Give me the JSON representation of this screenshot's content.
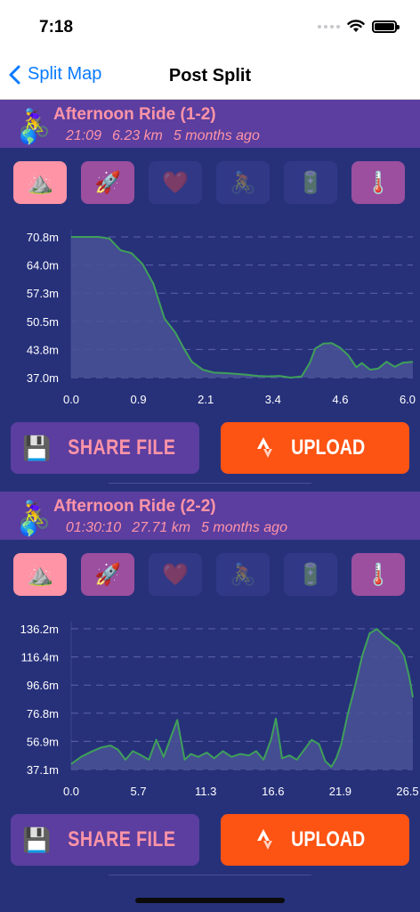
{
  "status": {
    "time": "7:18"
  },
  "nav": {
    "back_label": "Split Map",
    "title": "Post Split"
  },
  "rides": [
    {
      "title": "Afternoon Ride (1-2)",
      "rider_emoji": "🚴‍♀️",
      "globe_emoji": "🌎",
      "duration": "21:09",
      "distance": "6.23 km",
      "ago": "5 months ago",
      "metrics": [
        {
          "name": "elevation",
          "emoji": "⛰️",
          "state": "active-pink"
        },
        {
          "name": "speed",
          "emoji": "🚀",
          "state": "active-purple"
        },
        {
          "name": "heart-rate",
          "emoji": "❤️",
          "state": "inactive"
        },
        {
          "name": "cadence",
          "emoji": "🚴",
          "state": "inactive"
        },
        {
          "name": "power",
          "emoji": "🔋",
          "state": "inactive"
        },
        {
          "name": "temperature",
          "emoji": "🌡️",
          "state": "active-purple"
        }
      ],
      "share_label": "SHARE FILE",
      "upload_label": "UPLOAD",
      "chart_data": {
        "type": "area",
        "ylabel": "",
        "xlabel": "",
        "yticks": [
          "70.8m",
          "64.0m",
          "57.3m",
          "50.5m",
          "43.8m",
          "37.0m"
        ],
        "xticks": [
          "0.0",
          "0.9",
          "2.1",
          "3.4",
          "4.6",
          "6.0"
        ],
        "ylim": [
          37.0,
          70.8
        ],
        "xlim": [
          0.0,
          6.23
        ],
        "x": [
          0.0,
          0.3,
          0.5,
          0.7,
          0.9,
          1.1,
          1.3,
          1.5,
          1.7,
          1.9,
          2.05,
          2.2,
          2.4,
          2.6,
          2.8,
          3.0,
          3.2,
          3.4,
          3.6,
          3.8,
          4.0,
          4.2,
          4.35,
          4.45,
          4.6,
          4.75,
          4.9,
          5.05,
          5.2,
          5.3,
          5.45,
          5.6,
          5.75,
          5.9,
          6.05,
          6.23
        ],
        "y": [
          70.8,
          70.8,
          70.8,
          70.4,
          67.6,
          66.9,
          64.3,
          59.5,
          51.2,
          47.8,
          44.1,
          40.8,
          38.9,
          38.2,
          38.1,
          37.9,
          37.7,
          37.4,
          37.3,
          37.4,
          37.0,
          37.3,
          40.5,
          44.0,
          45.2,
          45.3,
          44.2,
          42.4,
          39.5,
          40.5,
          38.9,
          39.2,
          40.8,
          39.6,
          40.6,
          40.8
        ],
        "grid": true
      }
    },
    {
      "title": "Afternoon Ride (2-2)",
      "rider_emoji": "🚴‍♀️",
      "globe_emoji": "🌎",
      "duration": "01:30:10",
      "distance": "27.71 km",
      "ago": "5 months ago",
      "metrics": [
        {
          "name": "elevation",
          "emoji": "⛰️",
          "state": "active-pink"
        },
        {
          "name": "speed",
          "emoji": "🚀",
          "state": "active-purple"
        },
        {
          "name": "heart-rate",
          "emoji": "❤️",
          "state": "inactive"
        },
        {
          "name": "cadence",
          "emoji": "🚴",
          "state": "inactive"
        },
        {
          "name": "power",
          "emoji": "🔋",
          "state": "inactive"
        },
        {
          "name": "temperature",
          "emoji": "🌡️",
          "state": "active-purple"
        }
      ],
      "share_label": "SHARE FILE",
      "upload_label": "UPLOAD",
      "chart_data": {
        "type": "area",
        "ylabel": "",
        "xlabel": "",
        "yticks": [
          "136.2m",
          "116.4m",
          "96.6m",
          "76.8m",
          "56.9m",
          "37.1m"
        ],
        "xticks": [
          "0.0",
          "5.7",
          "11.3",
          "16.6",
          "21.9",
          "26.5"
        ],
        "ylim": [
          37.1,
          136.2
        ],
        "xlim": [
          0.0,
          27.71
        ],
        "x": [
          0.0,
          0.8,
          1.6,
          2.4,
          3.2,
          3.8,
          4.4,
          5.0,
          5.7,
          6.3,
          6.9,
          7.5,
          8.0,
          8.6,
          9.2,
          9.7,
          10.3,
          11.0,
          11.6,
          12.3,
          13.0,
          13.7,
          14.4,
          15.0,
          15.6,
          16.2,
          16.6,
          17.1,
          17.7,
          18.3,
          18.9,
          19.5,
          20.1,
          20.6,
          21.1,
          21.5,
          21.9,
          22.4,
          23.0,
          23.6,
          24.2,
          24.8,
          25.4,
          26.0,
          26.5,
          27.0,
          27.4,
          27.71
        ],
        "y": [
          41.0,
          46.0,
          49.5,
          52.5,
          54.0,
          51.0,
          44.0,
          50.0,
          47.0,
          44.0,
          58.0,
          46.0,
          58.0,
          72.0,
          44.0,
          48.0,
          46.0,
          49.0,
          45.0,
          50.0,
          46.0,
          48.0,
          47.0,
          50.0,
          44.0,
          58.0,
          73.0,
          45.0,
          47.0,
          44.0,
          51.0,
          58.0,
          55.0,
          43.0,
          39.0,
          45.0,
          55.0,
          75.0,
          95.0,
          117.0,
          133.0,
          136.0,
          131.0,
          127.0,
          124.0,
          117.0,
          103.0,
          88.0
        ],
        "grid": true
      }
    }
  ]
}
